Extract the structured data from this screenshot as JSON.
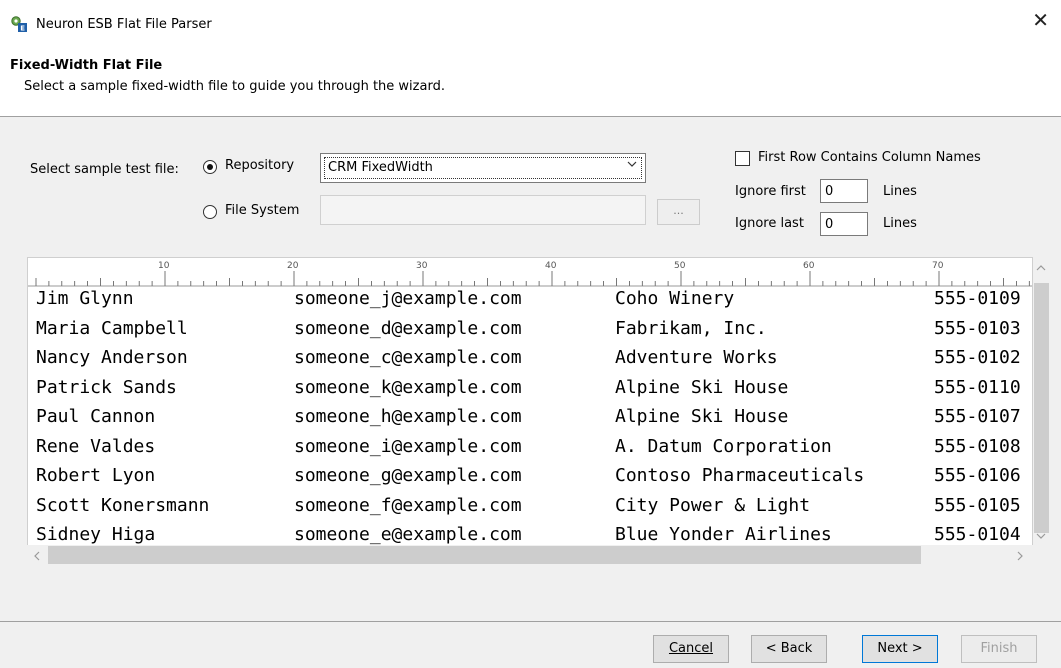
{
  "window": {
    "title": "Neuron ESB Flat File Parser",
    "close_glyph": "✕"
  },
  "header": {
    "title": "Fixed-Width Flat File",
    "subtitle": "Select a sample fixed-width file to guide you through the wizard."
  },
  "source": {
    "label": "Select sample test file:",
    "repository_label": "Repository",
    "repository_selected": true,
    "repository_value": "CRM FixedWidth",
    "filesystem_label": "File System",
    "filesystem_value": "",
    "browse_label": "..."
  },
  "options": {
    "first_row_label": "First Row Contains Column Names",
    "first_row_checked": false,
    "ignore_first_label": "Ignore first",
    "ignore_first_value": "0",
    "ignore_last_label": "Ignore last",
    "ignore_last_value": "0",
    "lines_label": "Lines"
  },
  "ruler": {
    "labels": [
      "10",
      "20",
      "30",
      "40",
      "50",
      "60",
      "70"
    ]
  },
  "rows": [
    {
      "name": "Jim Glynn",
      "email": "someone_j@example.com",
      "company": "Coho Winery",
      "phone": "555-0109"
    },
    {
      "name": "Maria Campbell",
      "email": "someone_d@example.com",
      "company": "Fabrikam, Inc.",
      "phone": "555-0103"
    },
    {
      "name": "Nancy Anderson",
      "email": "someone_c@example.com",
      "company": "Adventure Works",
      "phone": "555-0102"
    },
    {
      "name": "Patrick Sands",
      "email": "someone_k@example.com",
      "company": "Alpine Ski House",
      "phone": "555-0110"
    },
    {
      "name": "Paul Cannon",
      "email": "someone_h@example.com",
      "company": "Alpine Ski House",
      "phone": "555-0107"
    },
    {
      "name": "Rene Valdes",
      "email": "someone_i@example.com",
      "company": "A. Datum Corporation",
      "phone": "555-0108"
    },
    {
      "name": "Robert Lyon",
      "email": "someone_g@example.com",
      "company": "Contoso Pharmaceuticals",
      "phone": "555-0106"
    },
    {
      "name": "Scott Konersmann",
      "email": "someone_f@example.com",
      "company": "City Power & Light",
      "phone": "555-0105"
    },
    {
      "name": "Sidney Higa",
      "email": "someone_e@example.com",
      "company": "Blue Yonder Airlines",
      "phone": "555-0104"
    }
  ],
  "buttons": {
    "cancel": "Cancel",
    "back": "< Back",
    "next": "Next >",
    "finish": "Finish"
  },
  "icons": {
    "app": "gears-icon",
    "up": "▲",
    "down": "▼",
    "left": "◀",
    "right": "▶",
    "dropdown": "▼"
  }
}
